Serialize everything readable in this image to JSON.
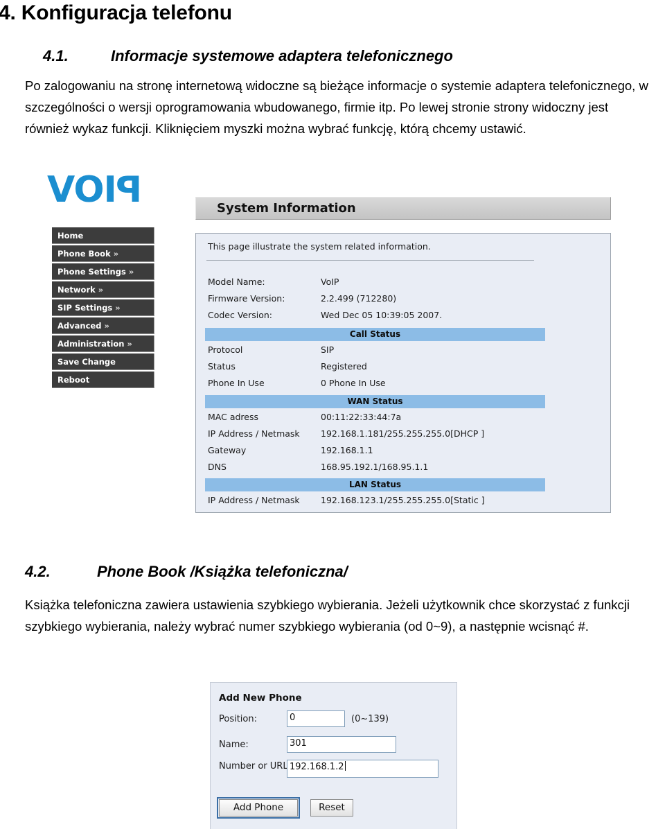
{
  "document": {
    "heading": "4. Konfiguracja telefonu",
    "section_4_1": {
      "number": "4.1.",
      "title": "Informacje systemowe adaptera telefonicznego",
      "paragraph": "Po zalogowaniu na stronę internetową widoczne są bieżące informacje o systemie adaptera telefonicznego, w szczególności o wersji oprogramowania wbudowanego, firmie itp. Po lewej stronie strony widoczny jest również wykaz funkcji. Kliknięciem myszki można wybrać  funkcję, którą chcemy ustawić."
    },
    "section_4_2": {
      "number": "4.2.",
      "title": "Phone Book /Książka telefoniczna/",
      "paragraph": "Książka telefoniczna zawiera ustawienia szybkiego wybierania. Jeżeli użytkownik chce skorzystać z funkcji szybkiego wybierania, należy wybrać numer szybkiego wybierania (od 0~9), a następnie wcisnąć #."
    }
  },
  "system_screenshot": {
    "logo": {
      "text_main": "VOI",
      "text_flipped": "P",
      "color": "#1b8ed0"
    },
    "sidebar": {
      "items": [
        {
          "label": "Home",
          "chevron": ""
        },
        {
          "label": "Phone Book",
          "chevron": "»"
        },
        {
          "label": "Phone Settings",
          "chevron": "»"
        },
        {
          "label": "Network",
          "chevron": "»"
        },
        {
          "label": "SIP Settings",
          "chevron": "»"
        },
        {
          "label": "Advanced",
          "chevron": "»"
        },
        {
          "label": "Administration",
          "chevron": "»"
        },
        {
          "label": "Save Change",
          "chevron": ""
        },
        {
          "label": "Reboot",
          "chevron": ""
        }
      ]
    },
    "panel": {
      "title": "System Information",
      "intro": "This page illustrate the system related information.",
      "general_rows": [
        {
          "label": "Model Name:",
          "value": "VoIP"
        },
        {
          "label": "Firmware Version:",
          "value": "2.2.499 (712280)"
        },
        {
          "label": "Codec Version:",
          "value": "Wed Dec 05 10:39:05 2007."
        }
      ],
      "call_status": {
        "header": "Call Status",
        "rows": [
          {
            "label": "Protocol",
            "value": "SIP"
          },
          {
            "label": "Status",
            "value": "Registered"
          },
          {
            "label": "Phone In Use",
            "value": "0 Phone In Use"
          }
        ]
      },
      "wan_status": {
        "header": "WAN Status",
        "rows": [
          {
            "label": "MAC adress",
            "value": "00:11:22:33:44:7a"
          },
          {
            "label": "IP Address / Netmask",
            "value": "192.168.1.181/255.255.255.0[DHCP ]"
          },
          {
            "label": "Gateway",
            "value": "192.168.1.1"
          },
          {
            "label": "DNS",
            "value": "168.95.192.1/168.95.1.1"
          }
        ]
      },
      "lan_status": {
        "header": "LAN Status",
        "rows": [
          {
            "label": "IP Address / Netmask",
            "value": "192.168.123.1/255.255.255.0[Static ]"
          }
        ]
      },
      "section_bar_color": "#8cbce6"
    }
  },
  "phonebook_screenshot": {
    "title": "Add New Phone",
    "fields": [
      {
        "label": "Position:",
        "value": "0",
        "hint": "(0~139)"
      },
      {
        "label": "Name:",
        "value": "301",
        "hint": ""
      },
      {
        "label": "Number or URL:",
        "value": "192.168.1.2",
        "hint": ""
      }
    ],
    "buttons": [
      {
        "label": "Add Phone",
        "focused": true
      },
      {
        "label": "Reset",
        "focused": false
      }
    ]
  }
}
